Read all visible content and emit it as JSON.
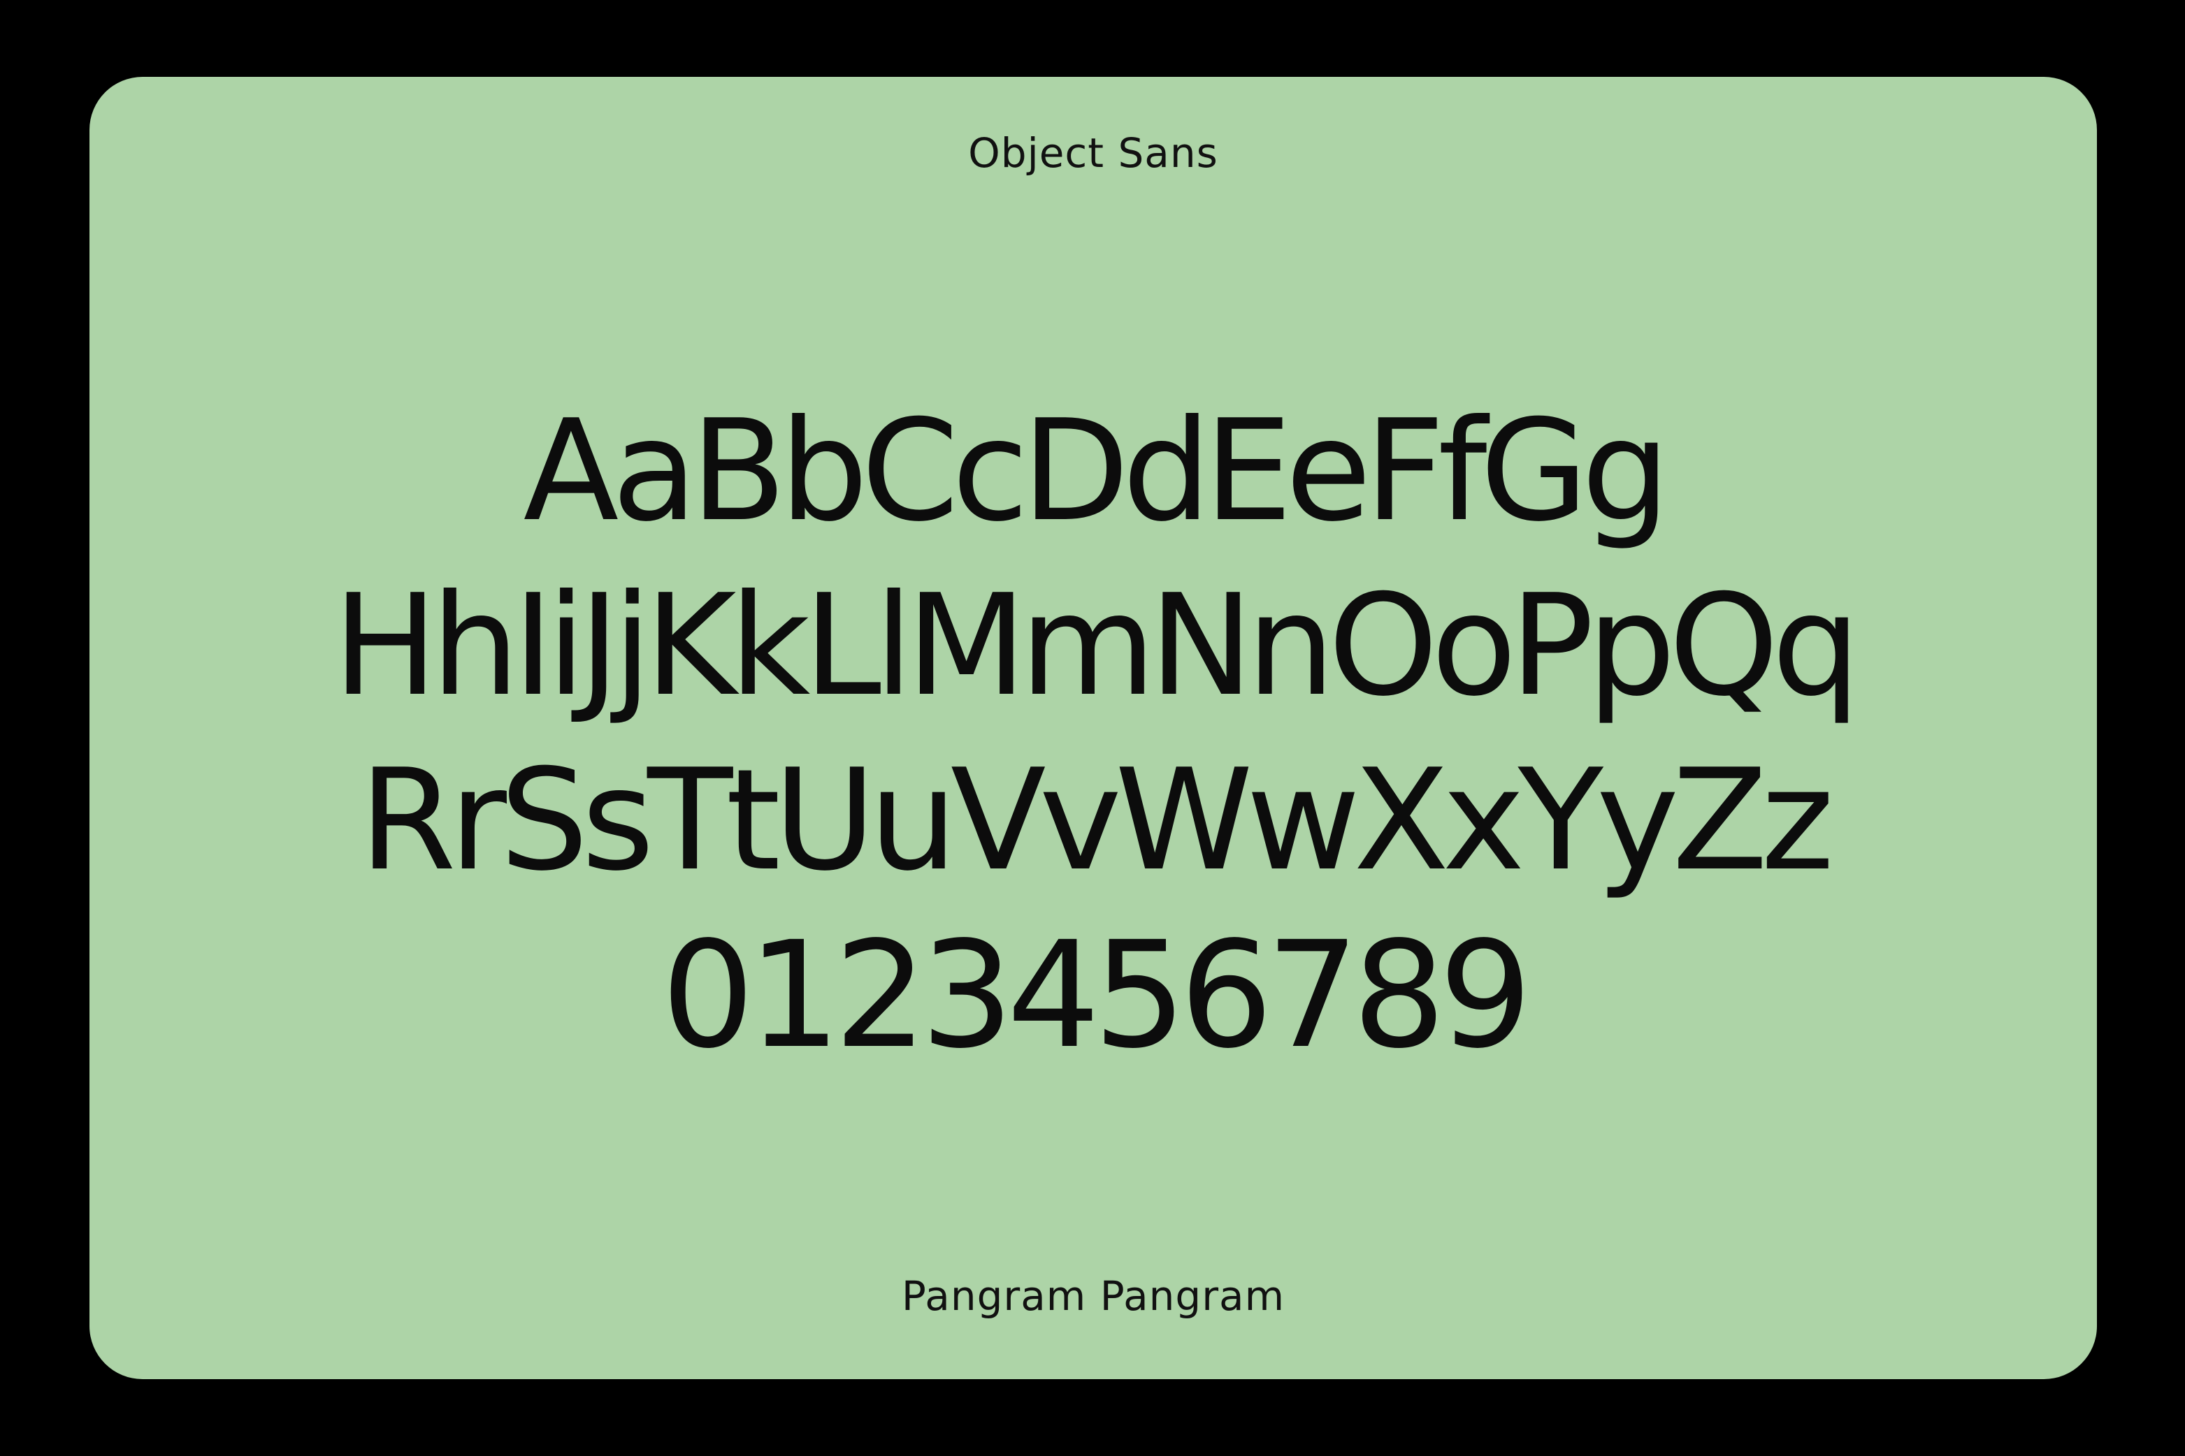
{
  "card": {
    "title": "Object Sans",
    "lines": [
      "AaBbCcDdEeFfGg",
      "HhIiJjKkLlMmNnOoPpQq",
      "RrSsTtUuVvWwXxYyZz",
      "0123456789"
    ],
    "footer": "Pangram Pangram"
  },
  "colors": {
    "background": "#000000",
    "card": "#add4a7",
    "text": "#0c0c0c"
  }
}
